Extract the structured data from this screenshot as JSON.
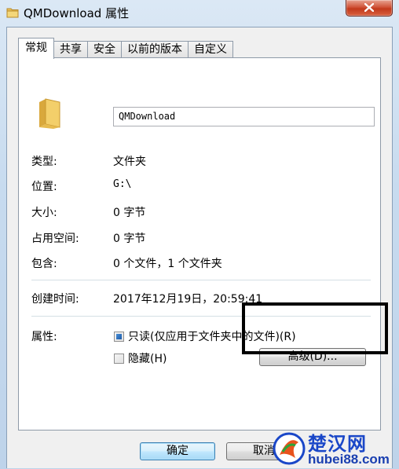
{
  "window": {
    "title": "QMDownload 属性",
    "icons": {
      "title": "folder-icon",
      "close": "close-icon"
    }
  },
  "tabs": [
    {
      "label": "常规",
      "active": true
    },
    {
      "label": "共享",
      "active": false
    },
    {
      "label": "安全",
      "active": false
    },
    {
      "label": "以前的版本",
      "active": false
    },
    {
      "label": "自定义",
      "active": false
    }
  ],
  "general": {
    "folder_name": "QMDownload",
    "type_label": "类型:",
    "type_value": "文件夹",
    "location_label": "位置:",
    "location_value": "G:\\",
    "size_label": "大小:",
    "size_value": "0 字节",
    "size_on_disk_label": "占用空间:",
    "size_on_disk_value": "0 字节",
    "contains_label": "包含:",
    "contains_value": "0 个文件，1 个文件夹",
    "created_label": "创建时间:",
    "created_value": "2017年12月19日，20:59:41",
    "attributes_label": "属性:",
    "readonly_label": "只读(仅应用于文件夹中的文件)(R)",
    "readonly_checked": true,
    "hidden_label": "隐藏(H)",
    "hidden_checked": false,
    "advanced_button": "高级(D)..."
  },
  "footer": {
    "ok_button": "确定",
    "cancel_button": "取消"
  },
  "watermark": {
    "title": "楚汉网",
    "url": "hubei88.com"
  },
  "colors": {
    "highlight_box": "#000000",
    "watermark_blue": "#1a47c8",
    "close_red": "#c23a1c"
  }
}
